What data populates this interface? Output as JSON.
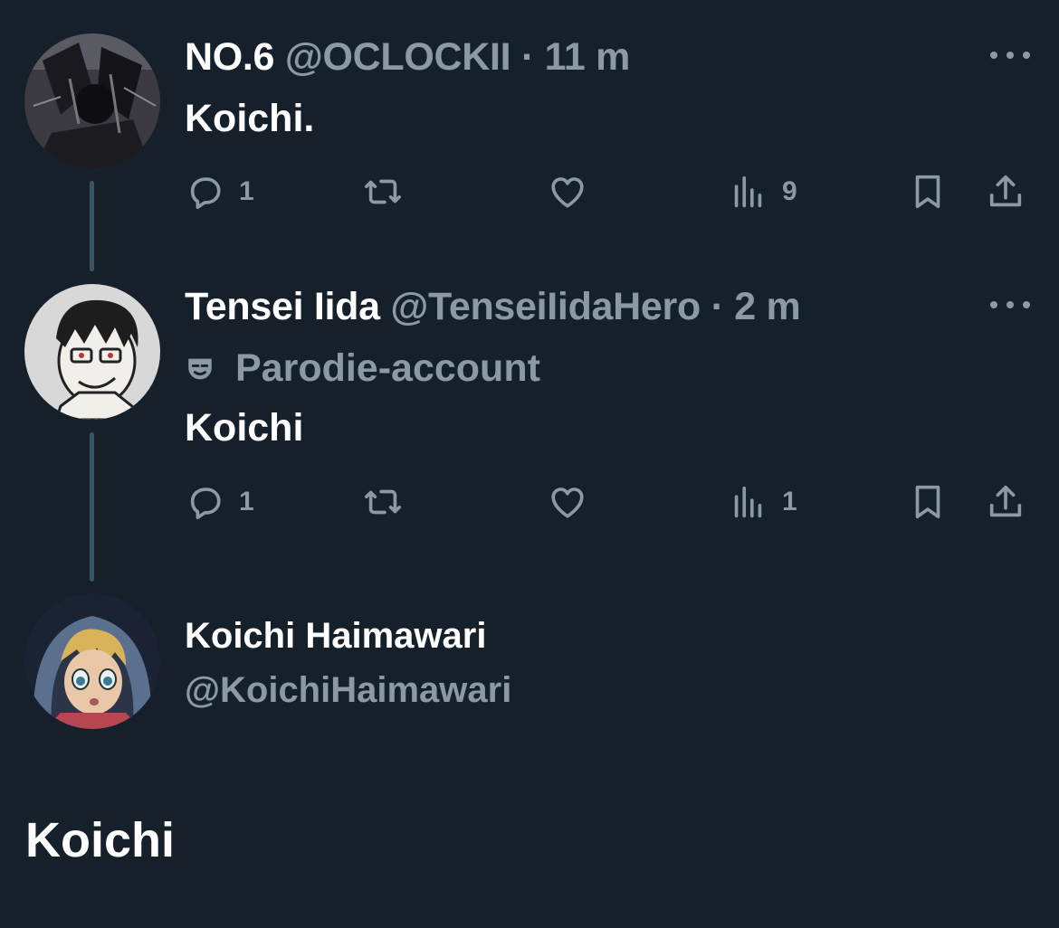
{
  "posts": [
    {
      "name": "NO.6",
      "handle": "@OCLOCKII",
      "separator": "·",
      "time": "11 m",
      "text": "Koichi.",
      "avatar_icon": "dark-manga-avatar",
      "actions": {
        "reply_count": "1",
        "repost_count": "",
        "like_count": "",
        "views_count": "9"
      }
    },
    {
      "name": "Tensei Iida",
      "handle": "@TenseiIidaHero",
      "separator": "·",
      "time": "2 m",
      "label": "Parodie-account",
      "label_icon": "theater-mask-icon",
      "text": "Koichi",
      "avatar_icon": "sketch-avatar",
      "actions": {
        "reply_count": "1",
        "repost_count": "",
        "like_count": "",
        "views_count": "1"
      }
    }
  ],
  "main_post": {
    "name": "Koichi Haimawari",
    "handle": "@KoichiHaimawari",
    "text": "Koichi",
    "avatar_icon": "hooded-anime-avatar"
  },
  "colors": {
    "background": "#16202a",
    "primary_text": "#ffffff",
    "secondary_text": "#8b98a5",
    "thread_line": "#3d5466"
  }
}
